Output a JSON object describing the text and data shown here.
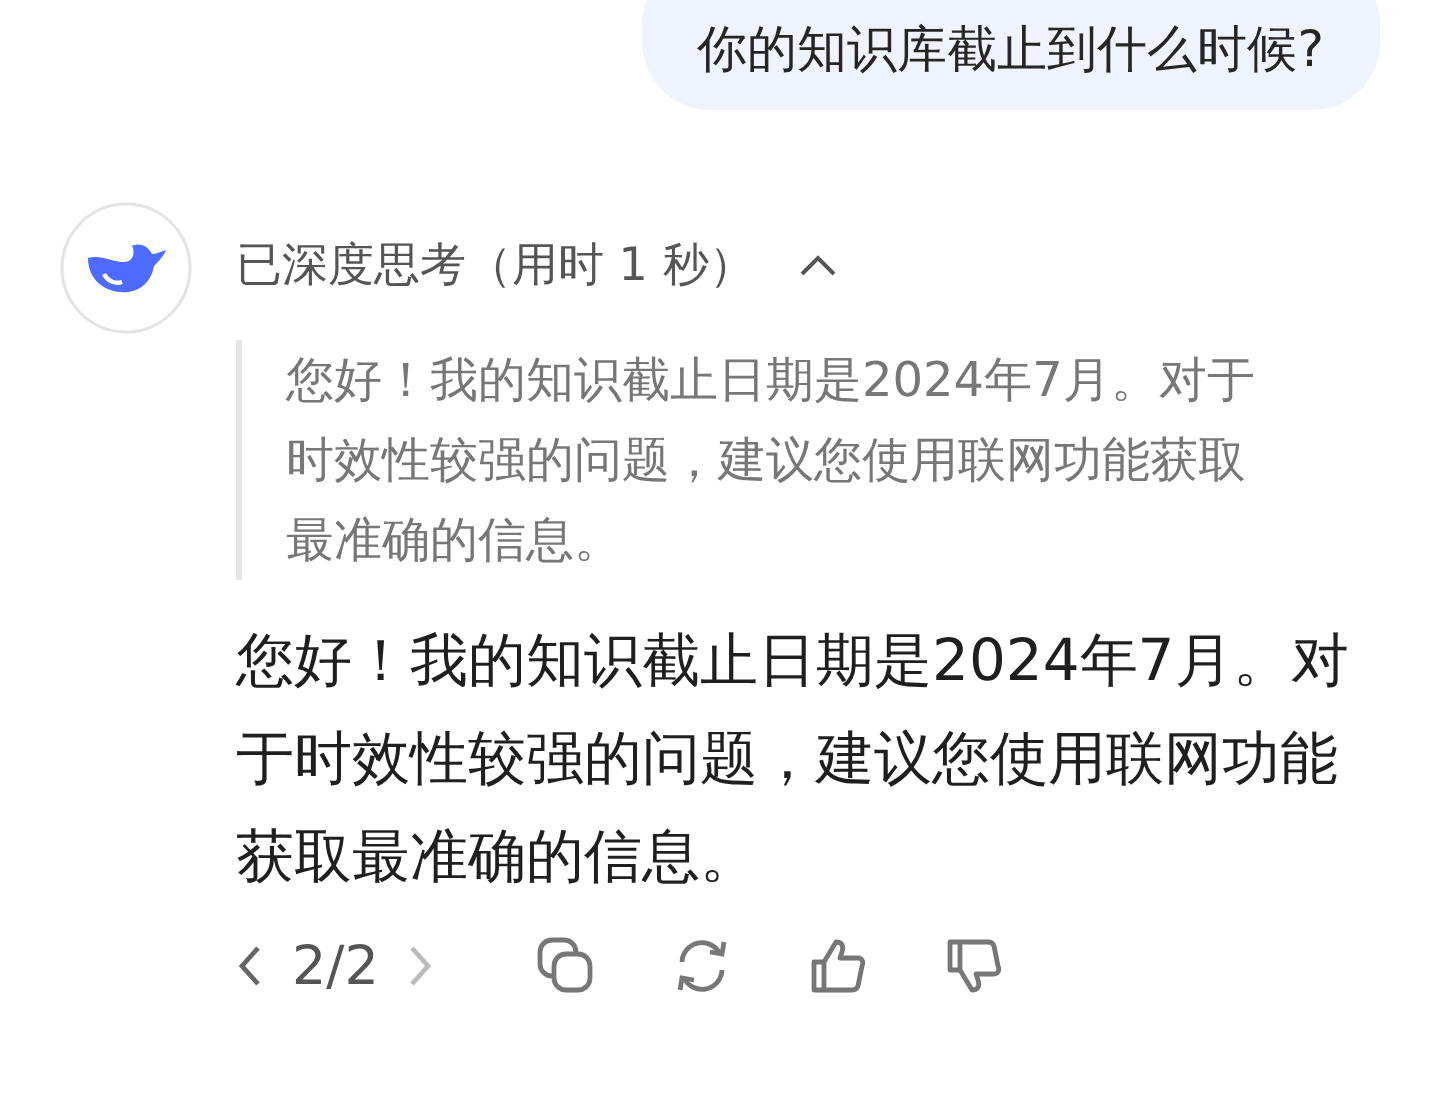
{
  "user_message": {
    "text": "你的知识库截止到什么时候?"
  },
  "thinking": {
    "label": "已深度思考（用时 1 秒）",
    "expanded": true,
    "text": "您好！我的知识截止日期是2024年7月。对于时效性较强的问题，建议您使用联网功能获取最准确的信息。"
  },
  "answer": {
    "text": "您好！我的知识截止日期是2024年7月。对于时效性较强的问题，建议您使用联网功能获取最准确的信息。"
  },
  "pager": {
    "label": "2/2",
    "prev_disabled": false,
    "next_disabled": true
  }
}
